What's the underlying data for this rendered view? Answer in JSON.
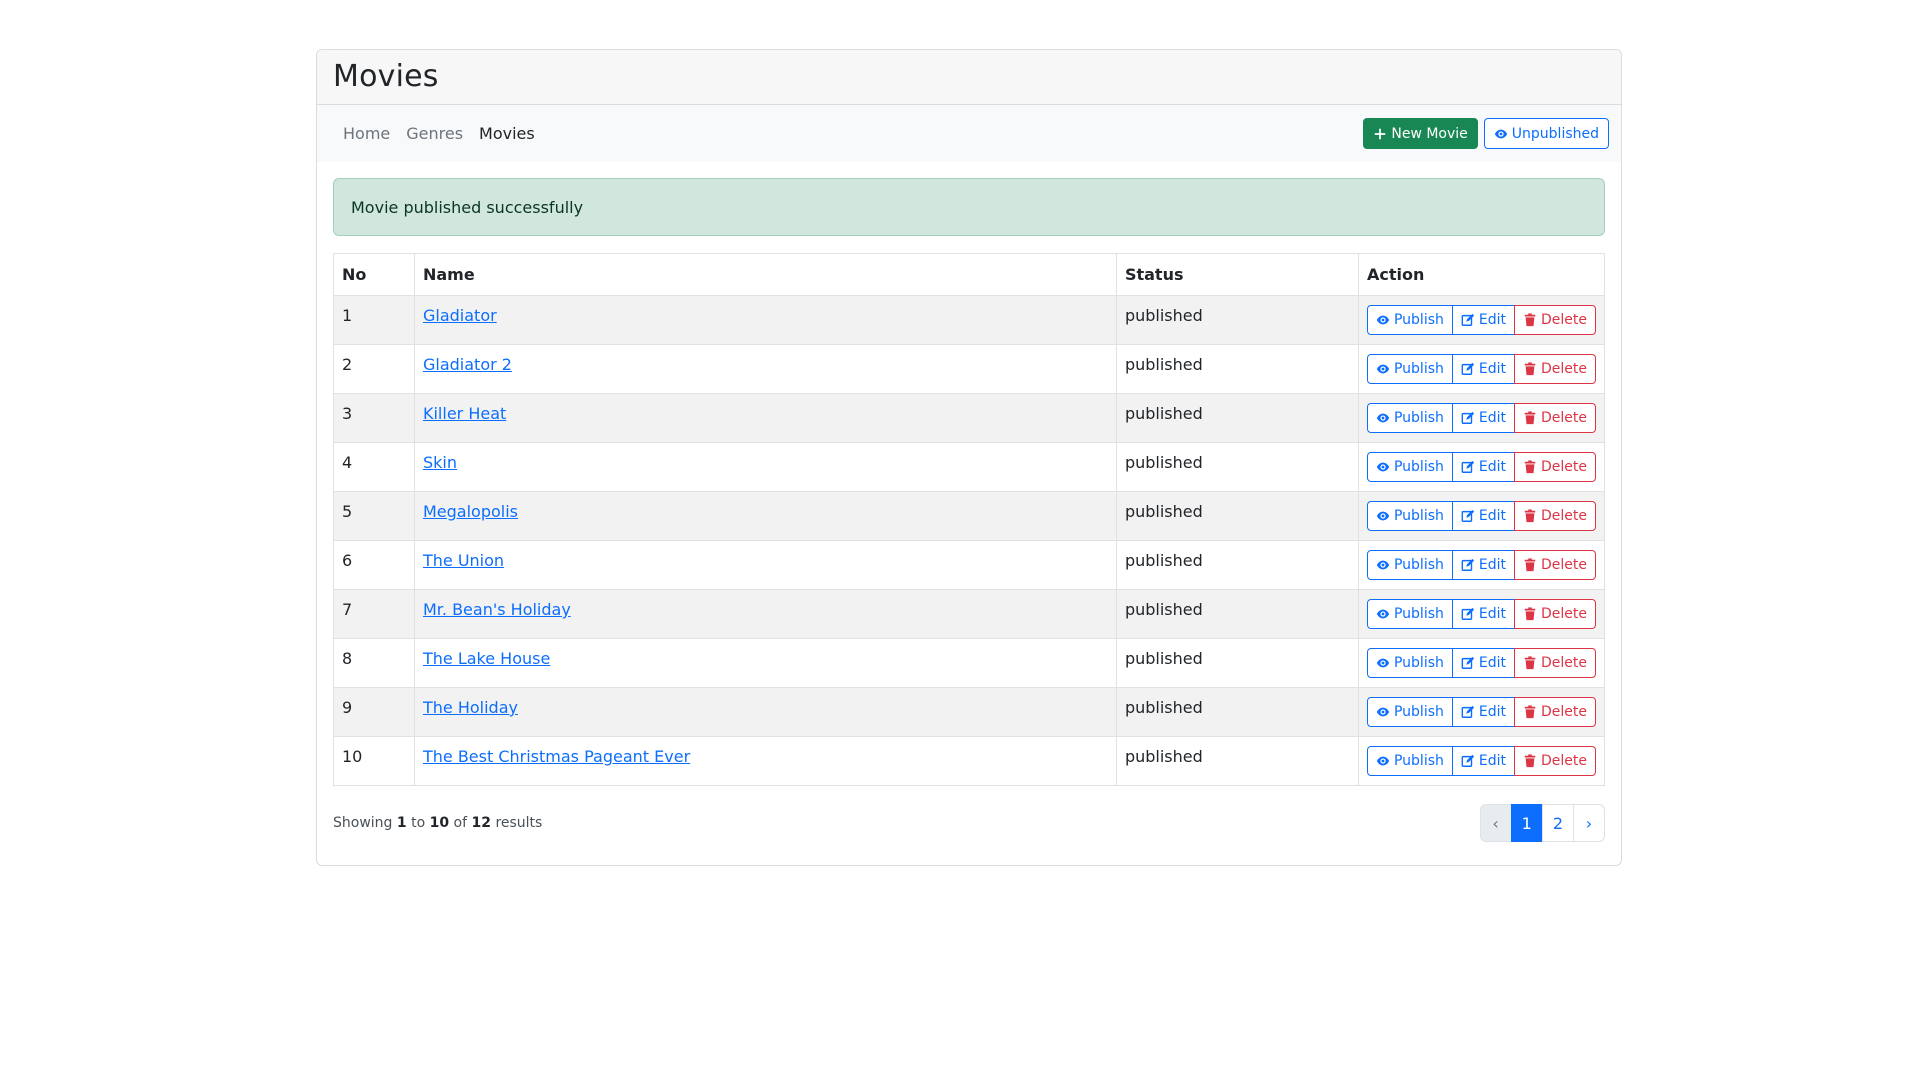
{
  "header": {
    "title": "Movies"
  },
  "nav": {
    "links": [
      {
        "label": "Home"
      },
      {
        "label": "Genres"
      },
      {
        "label": "Movies",
        "active": true
      }
    ],
    "new_movie_label": "New Movie",
    "unpublished_label": "Unpublished"
  },
  "alert": {
    "message": "Movie published successfully"
  },
  "table": {
    "headers": {
      "no": "No",
      "name": "Name",
      "status": "Status",
      "action": "Action"
    },
    "rows": [
      {
        "no": "1",
        "name": "Gladiator",
        "status": "published"
      },
      {
        "no": "2",
        "name": "Gladiator 2",
        "status": "published"
      },
      {
        "no": "3",
        "name": "Killer Heat",
        "status": "published"
      },
      {
        "no": "4",
        "name": "Skin",
        "status": "published"
      },
      {
        "no": "5",
        "name": "Megalopolis",
        "status": "published"
      },
      {
        "no": "6",
        "name": "The Union",
        "status": "published"
      },
      {
        "no": "7",
        "name": "Mr. Bean's Holiday",
        "status": "published"
      },
      {
        "no": "8",
        "name": "The Lake House",
        "status": "published"
      },
      {
        "no": "9",
        "name": "The Holiday",
        "status": "published"
      },
      {
        "no": "10",
        "name": "The Best Christmas Pageant Ever",
        "status": "published"
      }
    ],
    "action_labels": {
      "publish": "Publish",
      "edit": "Edit",
      "delete": "Delete"
    }
  },
  "pagination": {
    "showing": "Showing",
    "to": "to",
    "of": "of",
    "results": "results",
    "from_value": "1",
    "to_value": "10",
    "total": "12",
    "prev": "‹",
    "next": "›",
    "pages": [
      "1",
      "2"
    ],
    "current_page": "1"
  },
  "colors": {
    "primary": "#0d6efd",
    "success": "#198754",
    "danger": "#dc3545",
    "alert_bg": "#d1e7dd"
  }
}
